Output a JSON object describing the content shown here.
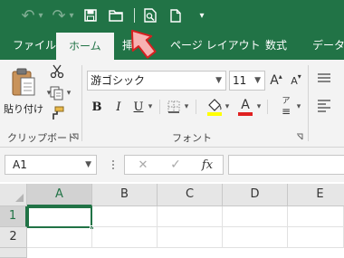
{
  "colors": {
    "accent": "#217346",
    "ribbon_bg": "#f3f3f3",
    "cursor_fill": "#f5a5a5",
    "cursor_outline": "#d62020"
  },
  "qat": {
    "buttons": [
      {
        "name": "undo-button",
        "icon": "undo-icon",
        "glyph": "↶"
      },
      {
        "name": "undo-dropdown",
        "icon": "chevron-down-icon",
        "glyph": "▾"
      },
      {
        "name": "redo-button",
        "icon": "redo-icon",
        "glyph": "↷"
      },
      {
        "name": "redo-dropdown",
        "icon": "chevron-down-icon",
        "glyph": "▾"
      },
      {
        "name": "save-button",
        "icon": "save-icon"
      },
      {
        "name": "open-button",
        "icon": "folder-icon"
      },
      {
        "name": "print-preview-button",
        "icon": "print-preview-icon"
      },
      {
        "name": "new-button",
        "icon": "new-document-icon"
      },
      {
        "name": "customize-qat-button",
        "icon": "customize-icon",
        "glyph": "▾"
      }
    ]
  },
  "tabs": {
    "file": "ファイル",
    "home": "ホーム",
    "insert": "挿",
    "page_layout": "ページ レイアウト",
    "formulas": "数式",
    "data": "データ"
  },
  "clipboard": {
    "paste_label": "貼り付け",
    "group_label": "クリップボード"
  },
  "font": {
    "font_name": "游ゴシック",
    "font_size": "11",
    "group_label": "フォント",
    "bold": "B",
    "italic": "I",
    "underline": "U",
    "grow": "A",
    "shrink": "A",
    "font_color_letter": "A",
    "phonetic": "ア"
  },
  "formula_bar": {
    "name_box": "A1",
    "cancel": "✕",
    "enter": "✓",
    "fx": "fx"
  },
  "grid": {
    "columns": [
      "A",
      "B",
      "C",
      "D",
      "E"
    ],
    "rows": [
      "1",
      "2"
    ]
  }
}
